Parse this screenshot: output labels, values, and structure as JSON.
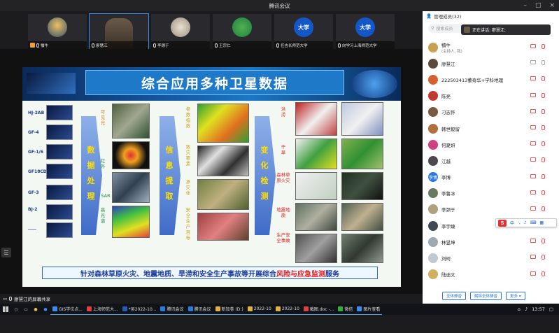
{
  "window": {
    "title": "腾讯会议"
  },
  "video_tiles": [
    {
      "name": "犢牛",
      "host": true,
      "mic": "on"
    },
    {
      "name": "廖慧江",
      "host": false,
      "mic": "on",
      "active": true
    },
    {
      "name": "李颈于",
      "host": false,
      "mic": "on"
    },
    {
      "name": "王宗仁",
      "host": false,
      "mic": "on"
    },
    {
      "name": "任吉长师范大学",
      "host": false,
      "mic": "on",
      "avatar_text": "大学"
    },
    {
      "name": "向学习上海师范大学",
      "host": false,
      "mic": "on",
      "avatar_text": "大学"
    }
  ],
  "slide": {
    "title": "综合应用多种卫星数据",
    "satellites": [
      "HJ-2AB",
      "GF-4",
      "GF-1/6",
      "GF18CD",
      "GF-3",
      "BJ-2",
      "……"
    ],
    "arrow_1": "数据处理",
    "arrow_2": "信息提取",
    "arrow_3": "变化检测",
    "data_types": [
      "可见光",
      "红外",
      "SAR",
      "高光谱"
    ],
    "params": [
      "参数指数",
      "致灾要素",
      "承灾体",
      "安全生产目标"
    ],
    "hazards": [
      "洪涝",
      "干旱",
      "森林草原火灾",
      "地震地质",
      "生产安全事故"
    ],
    "footer_pre": "针对森林草原火灾、地震地质、旱涝和安全生产事故等开展综合",
    "footer_hl": "风险与应急监测",
    "footer_post": "服务"
  },
  "share_bar": {
    "text": "廖慧江的屏幕共享"
  },
  "panel": {
    "title": "管理成员(32)",
    "search_placeholder": "搜索成员",
    "speaking": "正在讲话: 廖慧江;",
    "members": [
      {
        "name": "犢牛",
        "sub": "(主持人, 我)",
        "avatar_color": "#c8a050"
      },
      {
        "name": "廖慧江",
        "sub": "",
        "avatar_color": "#5a4a3a"
      },
      {
        "name": "222503413董奇华+学科地理",
        "sub": "",
        "avatar_color": "#d86030"
      },
      {
        "name": "陈亮",
        "sub": "",
        "avatar_color": "#c03a30"
      },
      {
        "name": "刁志怀",
        "sub": "",
        "avatar_color": "#7a5a40"
      },
      {
        "name": "韩世毅留",
        "sub": "",
        "avatar_color": "#b07040"
      },
      {
        "name": "何夏妍",
        "sub": "",
        "avatar_color": "#d04080"
      },
      {
        "name": "江越",
        "sub": "",
        "avatar_color": "#504850"
      },
      {
        "name": "李博",
        "sub": "",
        "avatar_color": "#2a7ae2",
        "avatar_text": "李博"
      },
      {
        "name": "李鲁冰",
        "sub": "",
        "avatar_color": "#6a7a60"
      },
      {
        "name": "李颈于",
        "sub": "",
        "avatar_color": "#b0a080"
      },
      {
        "name": "李宇婕",
        "sub": "",
        "avatar_color": "#404850"
      },
      {
        "name": "林昱坤",
        "sub": "",
        "avatar_color": "#a0a8b0"
      },
      {
        "name": "刘珂",
        "sub": "",
        "avatar_color": "#c0c8d0"
      },
      {
        "name": "陆迪文",
        "sub": "",
        "avatar_color": "#d0b060"
      }
    ],
    "ime_toolbar": [
      "中",
      "·,",
      "⚲"
    ],
    "footer_buttons": [
      "全体静音",
      "解除全体静音",
      "更多 ▾"
    ]
  },
  "taskbar": {
    "items": [
      "GIS学位点...",
      "上海师范大...",
      "*吴2022-10...",
      "腾讯会议",
      "腾讯会议",
      "新加卷 (D:)",
      "2022-10",
      "2022-10",
      "截图.doc -...",
      "微信",
      "图片查看"
    ],
    "time": "13:57"
  }
}
